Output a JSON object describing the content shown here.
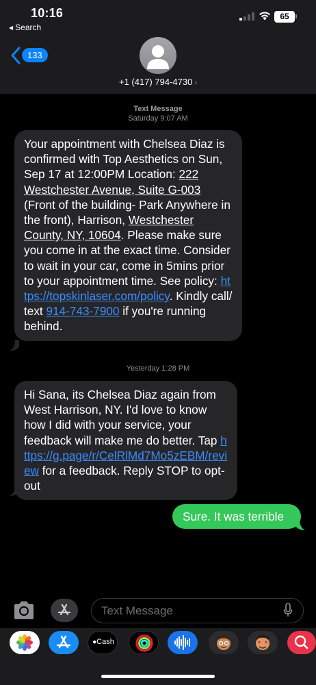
{
  "status_bar": {
    "time": "10:16",
    "back_label": "Search",
    "battery": "65"
  },
  "header": {
    "unread_count": "133",
    "contact_number": "+1 (417) 794-4730"
  },
  "thread": {
    "first_meta": {
      "type": "Text Message",
      "time": "Saturday 9:07 AM"
    },
    "msg1": {
      "p1": "Your appointment with Chelsea Diaz is confirmed with Top Aesthetics on Sun, Sep 17 at 12:00PM Location: ",
      "address": "222  Westchester Avenue, Suite G-003",
      "p2": " (Front of the building- Park Anywhere in the front), Harrison, ",
      "county": "Westchester County, NY, 10604",
      "p3": ". Please make sure you come in at the exact time. Consider to wait in your car, come in 5mins prior to your appointment time. See policy: ",
      "policy_link": "https://topskinlaser.com/policy",
      "p4": ". Kindly call/ text ",
      "phone_link": "914-743-7900",
      "p5": " if you're running behind."
    },
    "second_meta": {
      "time": "Yesterday 1:28 PM"
    },
    "msg2": {
      "p1": "Hi Sana, its Chelsea Diaz again from West Harrison, NY. I'd love to know how I did with your service, your feedback will make me do better. Tap ",
      "review_link": "https://g.page/r/CelRlMd7Mo5zEBM/review",
      "p2": " for a feedback. Reply STOP to opt-out"
    },
    "reply": "Sure. It was terrible"
  },
  "composer": {
    "placeholder": "Text Message"
  },
  "app_strip": {
    "apps": [
      "photos-icon",
      "app-store-icon",
      "apple-cash-icon",
      "fitness-icon",
      "audio-message-icon",
      "memoji-icon",
      "memoji-stickers-icon",
      "search-images-icon"
    ],
    "cash_label": "Cash"
  },
  "colors": {
    "incoming_bubble": "#262628",
    "outgoing_bubble": "#34c759",
    "link": "#3b8cff",
    "accent": "#0a84ff"
  }
}
